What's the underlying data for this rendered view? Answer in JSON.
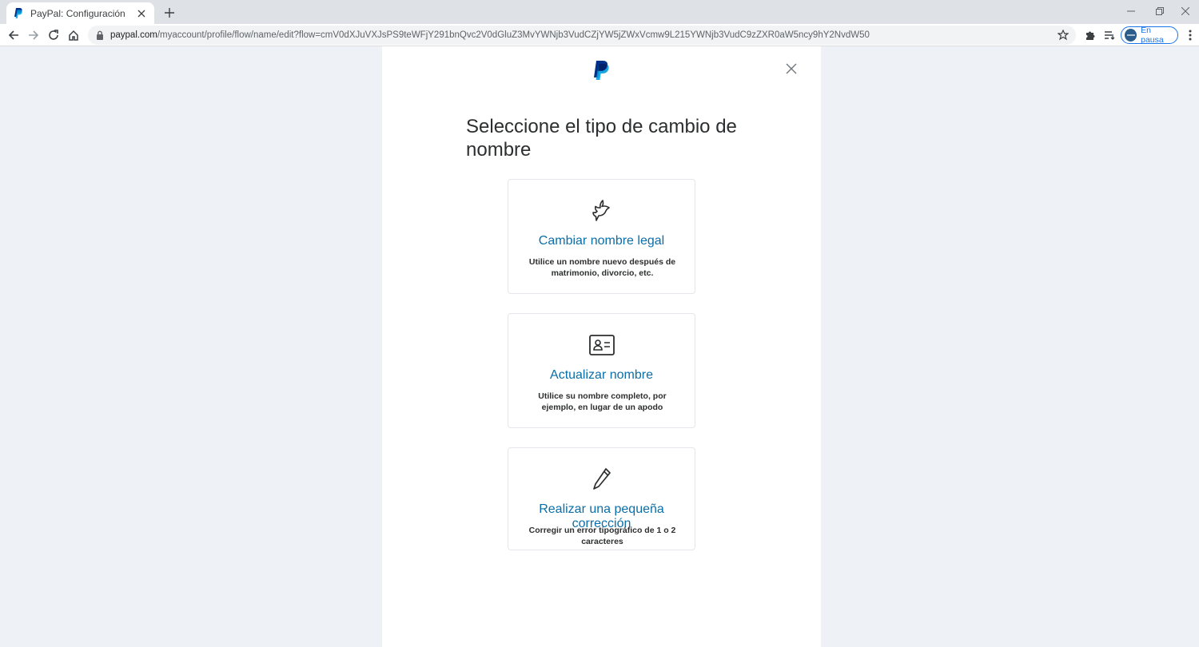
{
  "browser": {
    "tab_title": "PayPal: Configuración",
    "url_host": "paypal.com",
    "url_path": "/myaccount/profile/flow/name/edit?flow=cmV0dXJuVXJsPS9teWFjY291bnQvc2V0dGluZ3MvYWNjb3VudCZjYW5jZWxVcmw9L215YWNjb3VudC9zZXR0aW5ncy9hY2NvdW50",
    "profile_label": "En pausa"
  },
  "page": {
    "heading": "Seleccione el tipo de cambio de nombre",
    "options": [
      {
        "icon": "dove-icon",
        "title": "Cambiar nombre legal",
        "description": "Utilice un nombre nuevo después de matrimonio, divorcio, etc."
      },
      {
        "icon": "id-card-icon",
        "title": "Actualizar nombre",
        "description": "Utilice su nombre completo, por ejemplo, en lugar de un apodo"
      },
      {
        "icon": "pencil-icon",
        "title": "Realizar una pequeña corrección",
        "description": "Corregir un error tipográfico de 1 o 2 caracteres"
      }
    ]
  },
  "colors": {
    "link_blue": "#0a6ea8",
    "paypal_dark": "#003087",
    "paypal_light": "#009cde"
  }
}
